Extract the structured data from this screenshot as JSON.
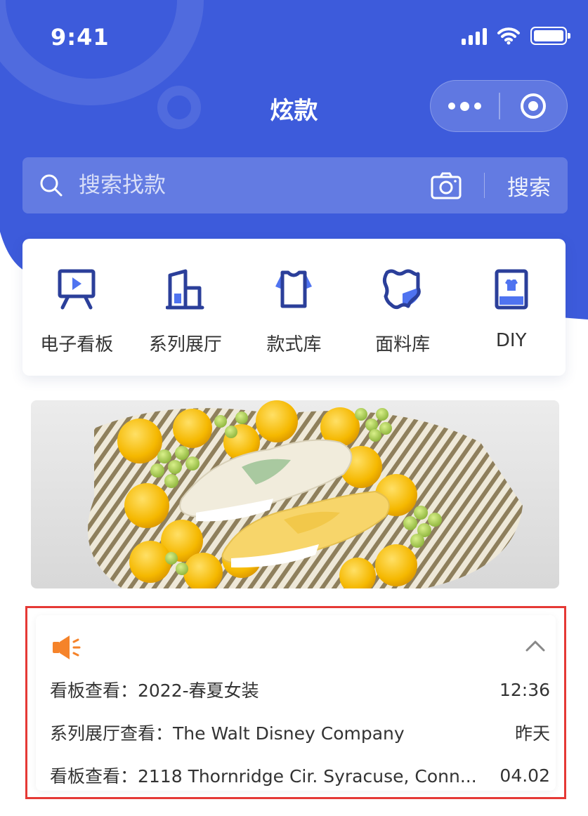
{
  "status": {
    "time": "9:41"
  },
  "nav": {
    "title": "炫款"
  },
  "search": {
    "placeholder": "搜索找款",
    "button_label": "搜索"
  },
  "shortcuts": [
    {
      "label": "电子看板",
      "icon": "presentation-board-icon"
    },
    {
      "label": "系列展厅",
      "icon": "buildings-icon"
    },
    {
      "label": "款式库",
      "icon": "shirt-icon"
    },
    {
      "label": "面料库",
      "icon": "fabric-icon"
    },
    {
      "label": "DIY",
      "icon": "tablet-shirt-icon"
    }
  ],
  "banner": {
    "image": "sneakers-on-lemons-grapes"
  },
  "notices": {
    "icon": "speaker-icon",
    "items": [
      {
        "text": "看板查看：2022-春夏女装",
        "time": "12:36"
      },
      {
        "text": "系列展厅查看：The Walt Disney Company",
        "time": "昨天"
      },
      {
        "text": "看板查看：2118 Thornridge Cir. Syracuse, Conn...",
        "time": "04.02"
      }
    ]
  },
  "colors": {
    "brand": "#3d5bdb",
    "accent_icon": "#2b3f9a",
    "speaker": "#f5832a",
    "highlight_border": "#e53935"
  }
}
